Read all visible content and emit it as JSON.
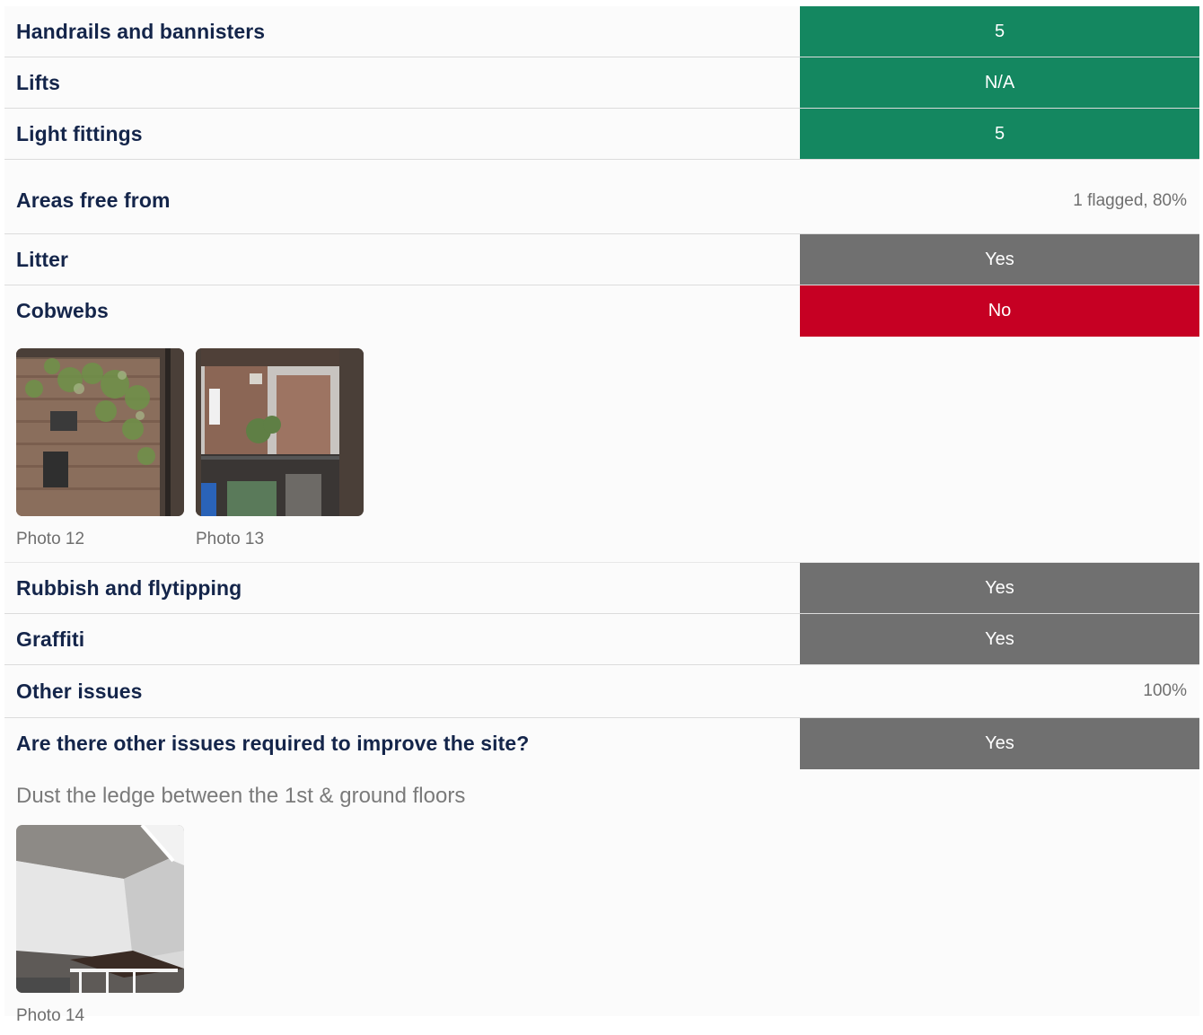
{
  "rows_top": [
    {
      "label": "Handrails and bannisters",
      "value": "5",
      "status": "green"
    },
    {
      "label": "Lifts",
      "value": "N/A",
      "status": "green"
    },
    {
      "label": "Light fittings",
      "value": "5",
      "status": "green"
    }
  ],
  "section_free": {
    "title": "Areas free from",
    "meta": "1 flagged, 80%"
  },
  "rows_free": [
    {
      "label": "Litter",
      "value": "Yes",
      "status": "gray"
    },
    {
      "label": "Cobwebs",
      "value": "No",
      "status": "red"
    }
  ],
  "photos_cobwebs": [
    {
      "caption": "Photo 12"
    },
    {
      "caption": "Photo 13"
    }
  ],
  "rows_free_more": [
    {
      "label": "Rubbish and flytipping",
      "value": "Yes",
      "status": "gray"
    },
    {
      "label": "Graffiti",
      "value": "Yes",
      "status": "gray"
    }
  ],
  "section_other": {
    "title": "Other issues",
    "meta": "100%"
  },
  "rows_other": [
    {
      "label": "Are there other issues required to improve the site?",
      "value": "Yes",
      "status": "gray"
    }
  ],
  "note_text": "Dust the ledge between the 1st & ground floors",
  "photos_other": [
    {
      "caption": "Photo 14"
    }
  ],
  "colors": {
    "green": "#148760",
    "gray": "#707070",
    "red": "#c60023",
    "label": "#14254a"
  }
}
